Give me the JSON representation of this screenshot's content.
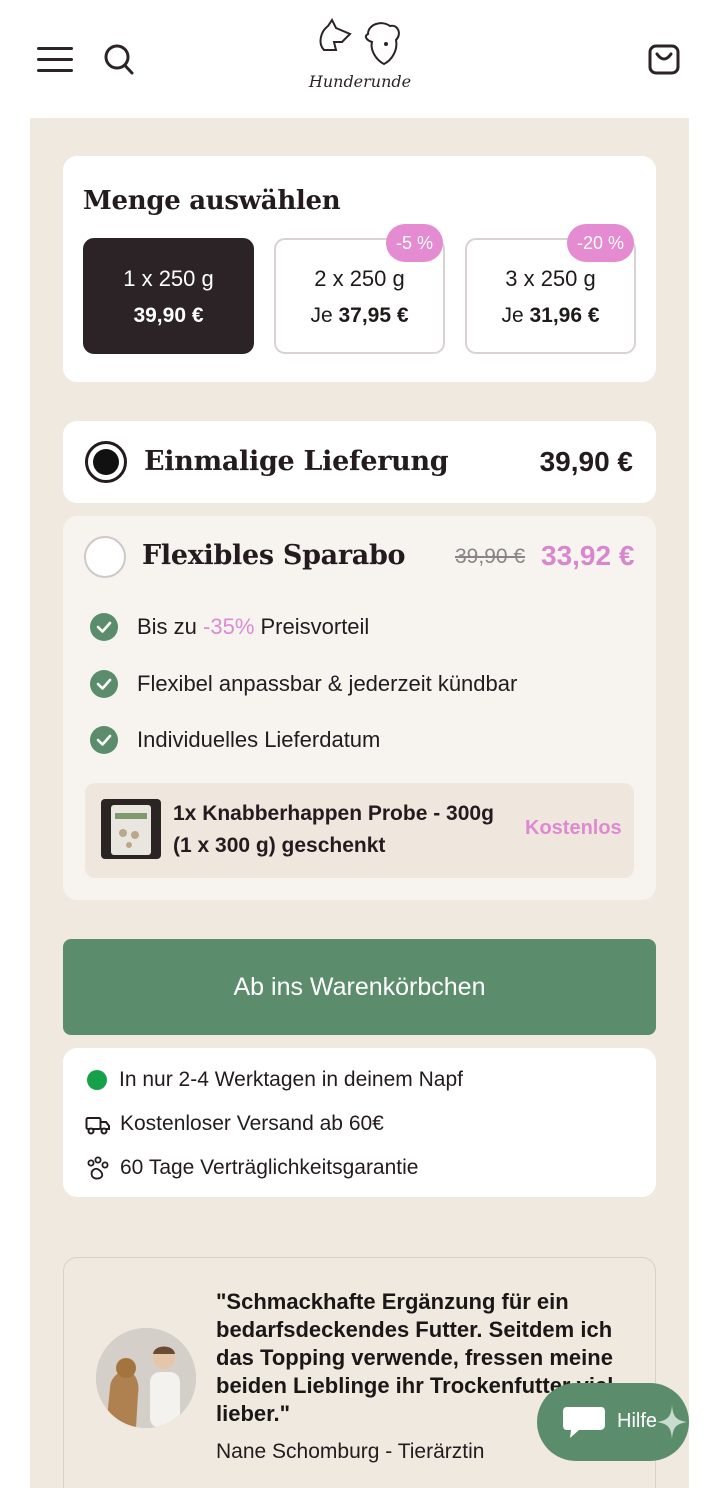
{
  "header": {
    "brand": "Hunderunde"
  },
  "quantity": {
    "title": "Menge auswählen",
    "options": [
      {
        "line1": "1 x 250 g",
        "price_prefix": "",
        "price": "39,90 €",
        "badge": ""
      },
      {
        "line1": "2 x 250 g",
        "price_prefix": "Je ",
        "price": "37,95 €",
        "badge": "-5 %"
      },
      {
        "line1": "3 x 250 g",
        "price_prefix": "Je ",
        "price": "31,96 €",
        "badge": "-20 %"
      }
    ],
    "selected_index": 0
  },
  "delivery": {
    "once": {
      "label": "Einmalige Lieferung",
      "price": "39,90 €",
      "checked": true
    },
    "abo": {
      "label": "Flexibles Sparabo",
      "old_price": "39,90 €",
      "price": "33,92 €",
      "checked": false,
      "benefit1_pre": "Bis zu ",
      "benefit1_highlight": "-35%",
      "benefit1_post": " Preisvorteil",
      "benefit2": "Flexibel anpassbar & jederzeit kündbar",
      "benefit3": "Individuelles Lieferdatum",
      "gift_line1": "1x Knabberhappen Probe - 300g",
      "gift_line2": "(1 x 300 g) geschenkt",
      "gift_price": "Kostenlos"
    }
  },
  "cta": {
    "label": "Ab ins Warenkörbchen"
  },
  "info": {
    "items": [
      {
        "text": "In nur 2-4 Werktagen in deinem Napf",
        "icon": "green-dot-icon"
      },
      {
        "text": "Kostenloser Versand ab 60€",
        "icon": "truck-icon"
      },
      {
        "text": "60 Tage Verträglichkeitsgarantie",
        "icon": "paw-icon"
      }
    ]
  },
  "testimonial": {
    "quote": "\"Schmackhafte Ergänzung für ein bedarfsdeckendes Futter. Seitdem ich das Topping verwende, fressen meine beiden Lieblinge ihr Trockenfutter viel lieber.\"",
    "author": "Nane Schomburg - Tierärztin"
  },
  "help": {
    "label": "Hilfe"
  },
  "colors": {
    "accent_green": "#5b8d6c",
    "accent_pink": "#dd8ad1",
    "dark": "#2b2326",
    "panel_beige": "#efe9e0"
  }
}
